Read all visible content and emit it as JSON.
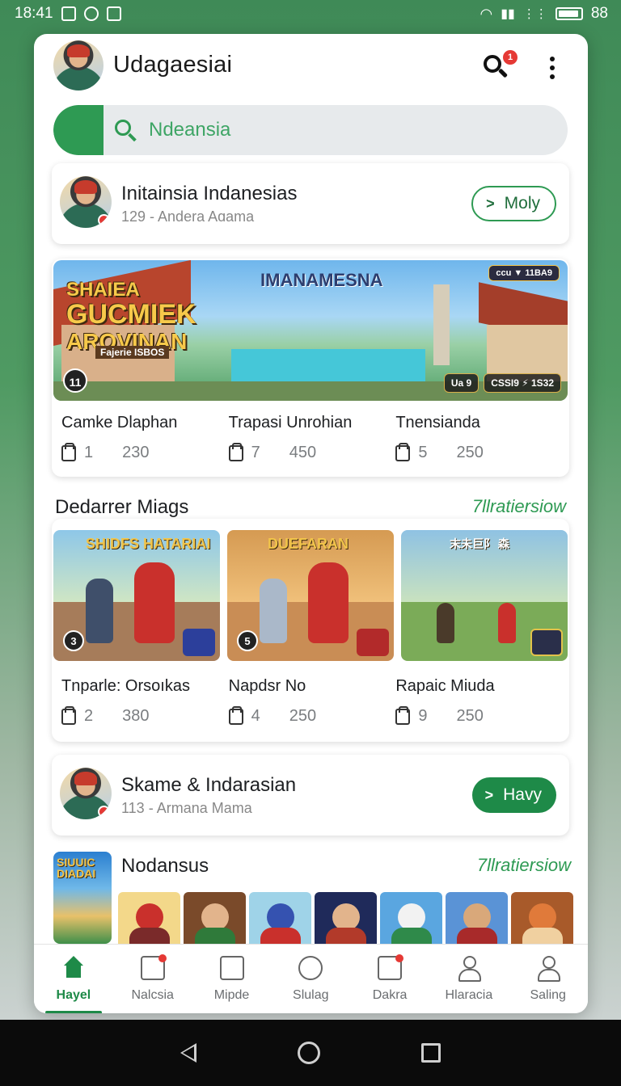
{
  "status_bar": {
    "time": "18:41",
    "left_icons": [
      "notification-icon",
      "settings-icon",
      "game-icon"
    ],
    "right_icons": [
      "wifi-icon",
      "signal-icon",
      "vibrate-icon",
      "battery-icon"
    ],
    "battery_level": "88"
  },
  "header": {
    "title": "Udagaesiai",
    "notification_count": "1"
  },
  "search": {
    "placeholder": "Ndeansia"
  },
  "profile_top": {
    "name": "Initainsia Indanesias",
    "subtitle": "129 - Andera Aɑama",
    "button_label": "Moly"
  },
  "featured": {
    "banner_title_line1": "SHAIEA",
    "banner_title_line2": "GUCMIEK",
    "banner_title_line3": "AROVINAN",
    "banner_subtitle": "Fajerie ISBOS",
    "banner_heading": "IMANAMESNA",
    "banner_top_badge": "ccu ▼ 11BA9",
    "banner_count": "11",
    "banner_res_1": "Ua 9",
    "banner_res_2": "CSSI9 ⚡ 1S32",
    "items": [
      {
        "name": "Camke Dlaphan",
        "count": "1",
        "value": "230"
      },
      {
        "name": "Trapasi Unrohian",
        "count": "7",
        "value": "450"
      },
      {
        "name": "Tnensianda",
        "count": "5",
        "value": "250"
      }
    ]
  },
  "section_games": {
    "title": "Dedarrer Miags",
    "link": "7llratiersiow",
    "items": [
      {
        "name": "Tnparle: Orsoıkas",
        "thumb_title": "SHIDFS HATARIAI",
        "thumb_num": "3",
        "count": "2",
        "value": "380"
      },
      {
        "name": "Napdsr No",
        "thumb_title": "DUEFARAN",
        "thumb_num": "5",
        "count": "4",
        "value": "250"
      },
      {
        "name": "Rapaic Miuda",
        "thumb_title": "末未巨阝 森",
        "thumb_num": "",
        "count": "9",
        "value": "250"
      }
    ]
  },
  "profile_bottom": {
    "name": "Skame & Indarasian",
    "subtitle": "113 - Armana Mama",
    "button_label": "Havy"
  },
  "section_nodansus": {
    "title": "Nodansus",
    "link": "7llratiersiow",
    "cover_text": "SIUUIC DIADAI"
  },
  "bottom_nav": [
    {
      "label": "Hayel",
      "icon": "home-icon",
      "active": true
    },
    {
      "label": "Nalcsia",
      "icon": "inbox-icon",
      "active": false
    },
    {
      "label": "Mipde",
      "icon": "list-icon",
      "active": false
    },
    {
      "label": "Slulag",
      "icon": "compass-icon",
      "active": false
    },
    {
      "label": "Dakra",
      "icon": "calendar-icon",
      "active": false
    },
    {
      "label": "Hlaracia",
      "icon": "person-icon",
      "active": false
    },
    {
      "label": "Saling",
      "icon": "profile-icon",
      "active": false
    }
  ],
  "colors": {
    "accent": "#1e8a48",
    "background": "#3f8a57",
    "badge": "#e53935"
  }
}
